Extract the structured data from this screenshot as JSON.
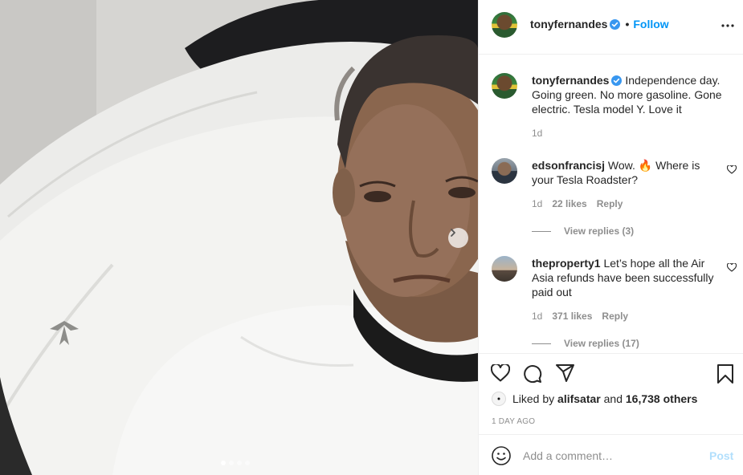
{
  "post": {
    "author": "tonyfernandes",
    "follow_label": "Follow",
    "separator": "•",
    "caption": "Independence day. Going green. No more gasoline. Gone electric. Tesla model Y. Love it",
    "caption_age": "1d",
    "carousel": {
      "slides": 4,
      "current": 1
    }
  },
  "comments": [
    {
      "user": "edsonfrancisj",
      "text": "Wow. 🔥 Where is your Tesla Roadster?",
      "age": "1d",
      "likes": "22 likes",
      "reply_label": "Reply",
      "view_replies": "View replies (3)"
    },
    {
      "user": "theproperty1",
      "text": "Let’s hope all the Air Asia refunds have been successfully paid out",
      "age": "1d",
      "likes": "371 likes",
      "reply_label": "Reply",
      "view_replies": "View replies (17)"
    }
  ],
  "likes": {
    "prefix": "Liked by",
    "user": "alifsatar",
    "joiner": "and",
    "others": "16,738 others"
  },
  "posted_time": "1 DAY AGO",
  "add_comment": {
    "placeholder": "Add a comment…",
    "post_label": "Post"
  },
  "icons": {
    "verified": "verified-badge-icon",
    "more": "more-options-icon",
    "like": "heart-icon",
    "comment": "comment-icon",
    "share": "share-icon",
    "save": "bookmark-icon",
    "emoji": "emoji-icon",
    "next": "chevron-right-icon"
  },
  "colors": {
    "link": "#0095f6",
    "verified": "#3897f0",
    "post_disabled": "#b2dffc",
    "muted": "#8e8e8e"
  }
}
